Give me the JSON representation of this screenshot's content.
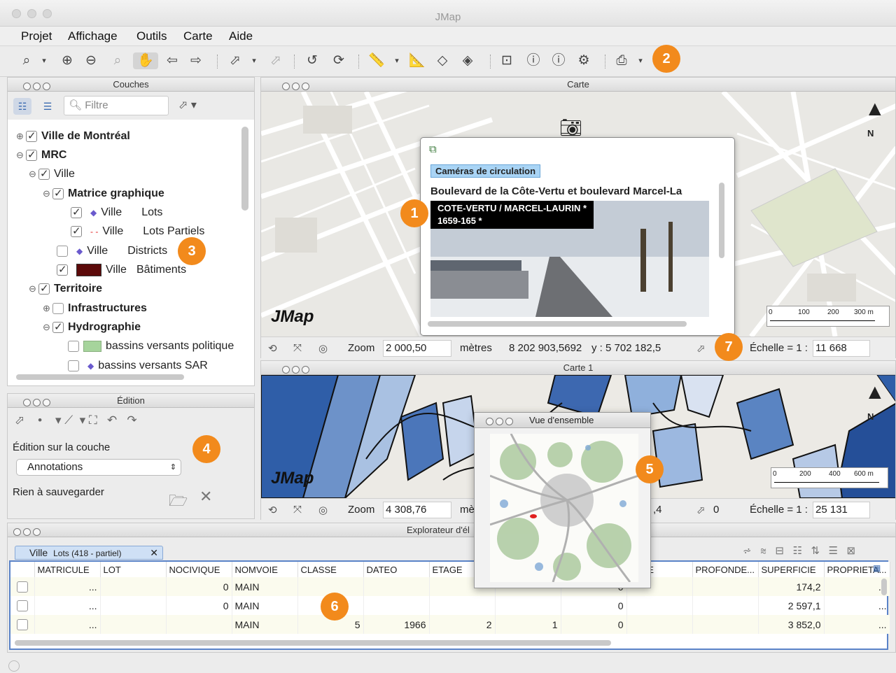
{
  "app": {
    "title": "JMap"
  },
  "menu": [
    "Projet",
    "Affichage",
    "Outils",
    "Carte",
    "Aide"
  ],
  "badges": [
    "1",
    "2",
    "3",
    "4",
    "5",
    "6",
    "7"
  ],
  "layers_panel": {
    "title": "Couches",
    "filter_placeholder": "Filtre",
    "tree": [
      {
        "label": "Ville de Montréal",
        "bold": true,
        "checked": true,
        "expander": "⊕"
      },
      {
        "label": "MRC",
        "bold": true,
        "checked": true,
        "expander": "⊖"
      },
      {
        "label": "Ville",
        "bold": false,
        "checked": true,
        "expander": "⊖"
      },
      {
        "label": "Matrice graphique",
        "bold": true,
        "checked": true,
        "expander": "⊖"
      },
      {
        "label": "Ville",
        "label2": "Lots",
        "bold": false,
        "checked": true
      },
      {
        "label": "Ville",
        "label2": "Lots Partiels",
        "bold": false,
        "checked": true
      },
      {
        "label": "Ville",
        "label2": "Districts",
        "bold": false,
        "checked": false
      },
      {
        "label": "Ville",
        "label2": "Bâtiments",
        "bold": false,
        "checked": true
      },
      {
        "label": "Territoire",
        "bold": true,
        "checked": true,
        "expander": "⊖"
      },
      {
        "label": "Infrastructures",
        "bold": true,
        "checked": false,
        "expander": "⊕"
      },
      {
        "label": "Hydrographie",
        "bold": true,
        "checked": true,
        "expander": "⊖"
      },
      {
        "label": "bassins versants politique",
        "bold": false,
        "checked": false
      },
      {
        "label": "bassins versants SAR",
        "bold": false,
        "checked": false
      }
    ]
  },
  "edition_panel": {
    "title": "Édition",
    "layer_label": "Édition sur la couche",
    "layer_value": "Annotations",
    "status": "Rien à sauvegarder"
  },
  "map1": {
    "title": "Carte",
    "logo": "JMap",
    "north": "N",
    "scale_ticks": [
      "0",
      "100",
      "200",
      "300 m"
    ],
    "zoom_label": "Zoom",
    "zoom_value": "2 000,50",
    "units": "mètres",
    "x_coord": "8 202 903,5692",
    "y_coord": "y : 5 702 182,5",
    "scale_label": "Échelle = 1 :",
    "scale_value": "11 668",
    "popup": {
      "layer": "Caméras de circulation",
      "title": "Boulevard de la Côte-Vertu et boulevard Marcel-La",
      "cam_line1": "COTE-VERTU / MARCEL-LAURIN *",
      "cam_line2": "1659-165 *"
    }
  },
  "map2": {
    "title": "Carte 1",
    "logo": "JMap",
    "north": "N",
    "scale_ticks": [
      "0",
      "200",
      "400",
      "600 m"
    ],
    "zoom_label": "Zoom",
    "zoom_value": "4 308,76",
    "units_partial": "mè",
    "coord_partial": ",4",
    "angle": "0",
    "scale_label": "Échelle = 1 :",
    "scale_value": "25 131"
  },
  "overview": {
    "title": "Vue d'ensemble"
  },
  "explorer": {
    "title": "Explorateur d'él",
    "tab_layer": "Ville",
    "tab_detail": "Lots (418 - partiel)",
    "columns": [
      "",
      "MATRICULE",
      "LOT",
      "NOCIVIQUE",
      "NOMVOIE",
      "CLASSE",
      "DATEO",
      "ETAGE",
      "",
      "",
      "TAGE",
      "PROFONDE...",
      "SUPERFICIE",
      "PROPRIETA..."
    ],
    "rows": [
      [
        "",
        "...",
        "",
        "0",
        "MAIN",
        "",
        "",
        "",
        "",
        "0",
        "",
        "",
        "174,2",
        "..."
      ],
      [
        "",
        "...",
        "",
        "0",
        "MAIN",
        "",
        "",
        "",
        "",
        "0",
        "",
        "",
        "2 597,1",
        "..."
      ],
      [
        "",
        "...",
        "",
        "",
        "MAIN",
        "5",
        "1966",
        "2",
        "1",
        "0",
        "",
        "",
        "3 852,0",
        "..."
      ]
    ]
  }
}
